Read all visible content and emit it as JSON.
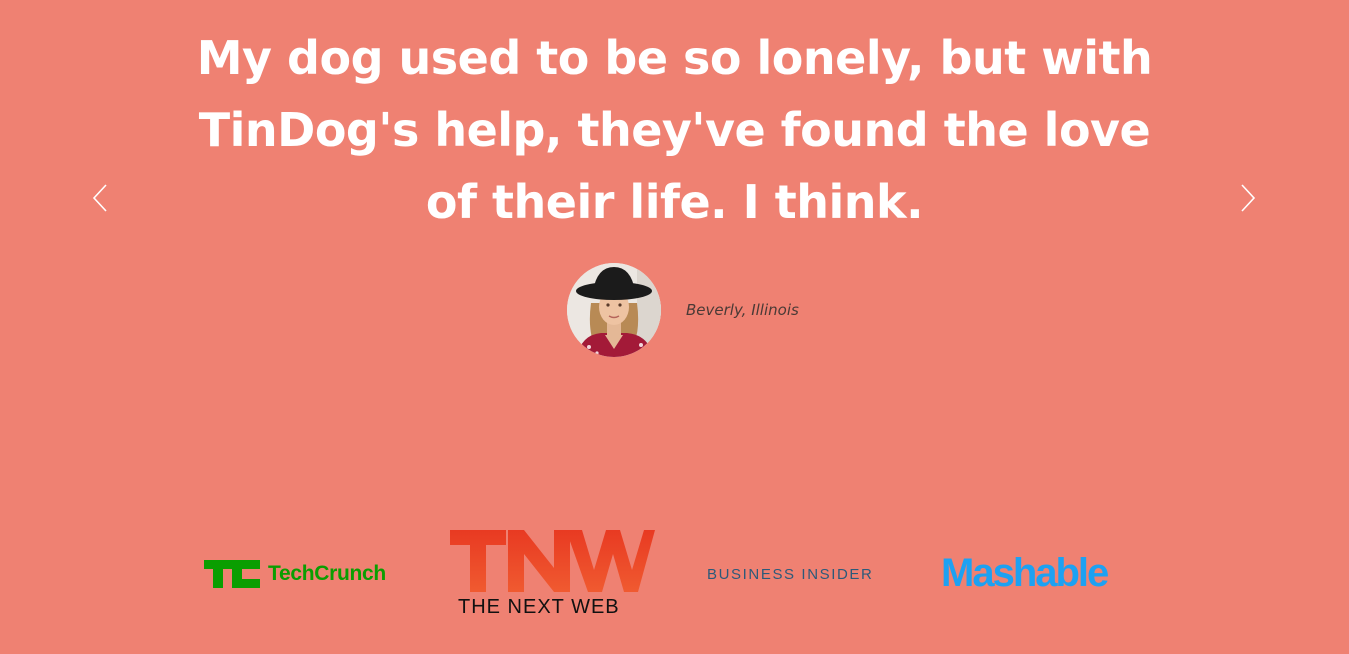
{
  "testimonial": {
    "quote": "My dog used to be so lonely, but with TinDog's help, they've found the love of their life. I think.",
    "author": "Beverly, Illinois"
  },
  "carousel": {
    "prev_icon": "chevron-left-icon",
    "next_icon": "chevron-right-icon"
  },
  "press": {
    "logos": [
      {
        "name": "TechCrunch",
        "text": "TechCrunch",
        "color": "#0a9e01"
      },
      {
        "name": "The Next Web",
        "mark": "TNW",
        "text": "THE NEXT WEB",
        "color": "#e8462a"
      },
      {
        "name": "Business Insider",
        "text": "BUSINESS INSIDER",
        "color": "#2c5a7a"
      },
      {
        "name": "Mashable",
        "text": "Mashable",
        "color": "#1da1f2"
      }
    ]
  },
  "colors": {
    "background": "#ef8172",
    "text": "#ffffff"
  }
}
